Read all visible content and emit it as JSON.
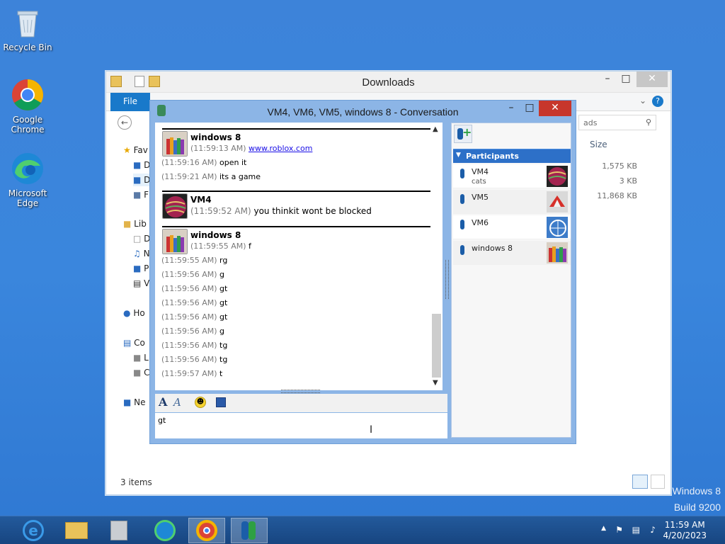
{
  "desktop": {
    "icons": [
      {
        "label": "Recycle Bin"
      },
      {
        "label": "Google Chrome"
      },
      {
        "label": "Microsoft Edge"
      }
    ],
    "watermark_line1": "Windows 8",
    "watermark_line2": "Build 9200"
  },
  "explorer": {
    "title": "Downloads",
    "file_tab": "File",
    "search_placeholder": "ads",
    "column_size": "Size",
    "nav_items": [
      "Fav",
      "D",
      "D",
      "F",
      "Lib",
      "D",
      "N",
      "P",
      "V",
      "Ho",
      "Co",
      "L",
      "C",
      "Ne"
    ],
    "file_sizes": [
      "1,575 KB",
      "3 KB",
      "11,868 KB"
    ],
    "status": "3 items"
  },
  "conversation": {
    "title": "VM4, VM6, VM5, windows 8 - Conversation",
    "blocks": [
      {
        "sender": "windows 8",
        "lines": [
          {
            "time": "(11:59:13 AM)",
            "text": "www.roblox.com",
            "link": true
          },
          {
            "time": "(11:59:16 AM)",
            "text": "open it"
          },
          {
            "time": "(11:59:21 AM)",
            "text": "its a game"
          }
        ]
      },
      {
        "sender": "VM4",
        "lines": [
          {
            "time": "(11:59:52 AM)",
            "text": "you thinkit wont be blocked"
          }
        ]
      },
      {
        "sender": "windows 8",
        "lines": [
          {
            "time": "(11:59:55 AM)",
            "text": "f"
          },
          {
            "time": "(11:59:55 AM)",
            "text": "rg"
          },
          {
            "time": "(11:59:56 AM)",
            "text": "g"
          },
          {
            "time": "(11:59:56 AM)",
            "text": "gt"
          },
          {
            "time": "(11:59:56 AM)",
            "text": "gt"
          },
          {
            "time": "(11:59:56 AM)",
            "text": "gt"
          },
          {
            "time": "(11:59:56 AM)",
            "text": "g"
          },
          {
            "time": "(11:59:56 AM)",
            "text": "tg"
          },
          {
            "time": "(11:59:56 AM)",
            "text": "tg"
          },
          {
            "time": "(11:59:57 AM)",
            "text": "t"
          }
        ]
      }
    ],
    "input_text": "gt",
    "participants_header": "Participants",
    "participants": [
      {
        "name": "VM4",
        "status": "cats"
      },
      {
        "name": "VM5",
        "status": ""
      },
      {
        "name": "VM6",
        "status": ""
      },
      {
        "name": "windows 8",
        "status": ""
      }
    ]
  },
  "taskbar": {
    "apps": [
      "internet-explorer",
      "file-explorer",
      "control-panel",
      "edge",
      "chrome",
      "messenger"
    ],
    "time": "11:59 AM",
    "date": "4/20/2023"
  }
}
